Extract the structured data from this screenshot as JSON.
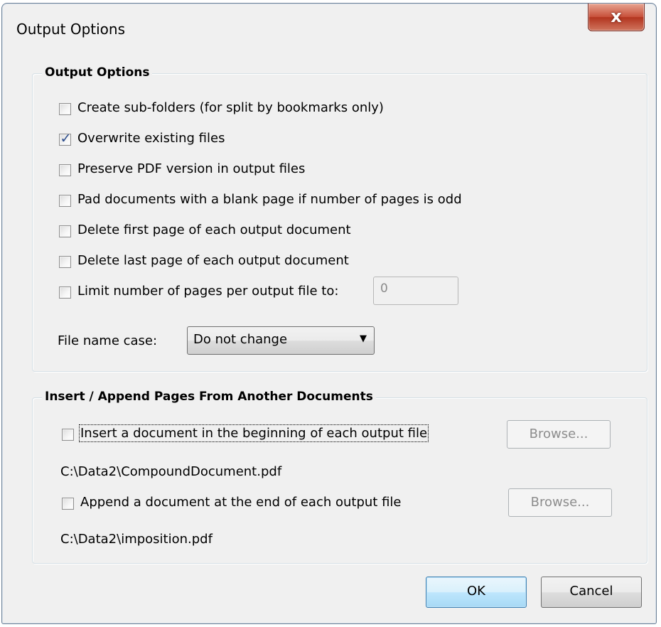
{
  "window": {
    "title": "Output Options"
  },
  "output_group": {
    "label": "Output Options",
    "options": [
      {
        "label": "Create sub-folders (for split by bookmarks only)",
        "checked": false
      },
      {
        "label": "Overwrite existing files",
        "checked": true
      },
      {
        "label": "Preserve PDF version in output files",
        "checked": false
      },
      {
        "label": "Pad documents with a blank page if number of pages is odd",
        "checked": false
      },
      {
        "label": "Delete first page of each output document",
        "checked": false
      },
      {
        "label": "Delete last page of each output document",
        "checked": false
      }
    ],
    "limit_pages": {
      "label": "Limit number of pages per output file to:",
      "checked": false,
      "value": "0"
    },
    "file_name_case": {
      "label": "File name case:",
      "selected": "Do not change"
    }
  },
  "insert_group": {
    "label": "Insert / Append Pages From Another Documents",
    "insert": {
      "label": "Insert a document in the beginning of each output file",
      "checked": false,
      "path": "C:\\Data2\\CompoundDocument.pdf",
      "browse_label": "Browse..."
    },
    "append": {
      "label": "Append a document at the end of each output file",
      "checked": false,
      "path": "C:\\Data2\\imposition.pdf",
      "browse_label": "Browse..."
    }
  },
  "buttons": {
    "ok": "OK",
    "cancel": "Cancel"
  },
  "icons": {
    "check": "✓",
    "close": "x",
    "dropdown": "▼"
  }
}
